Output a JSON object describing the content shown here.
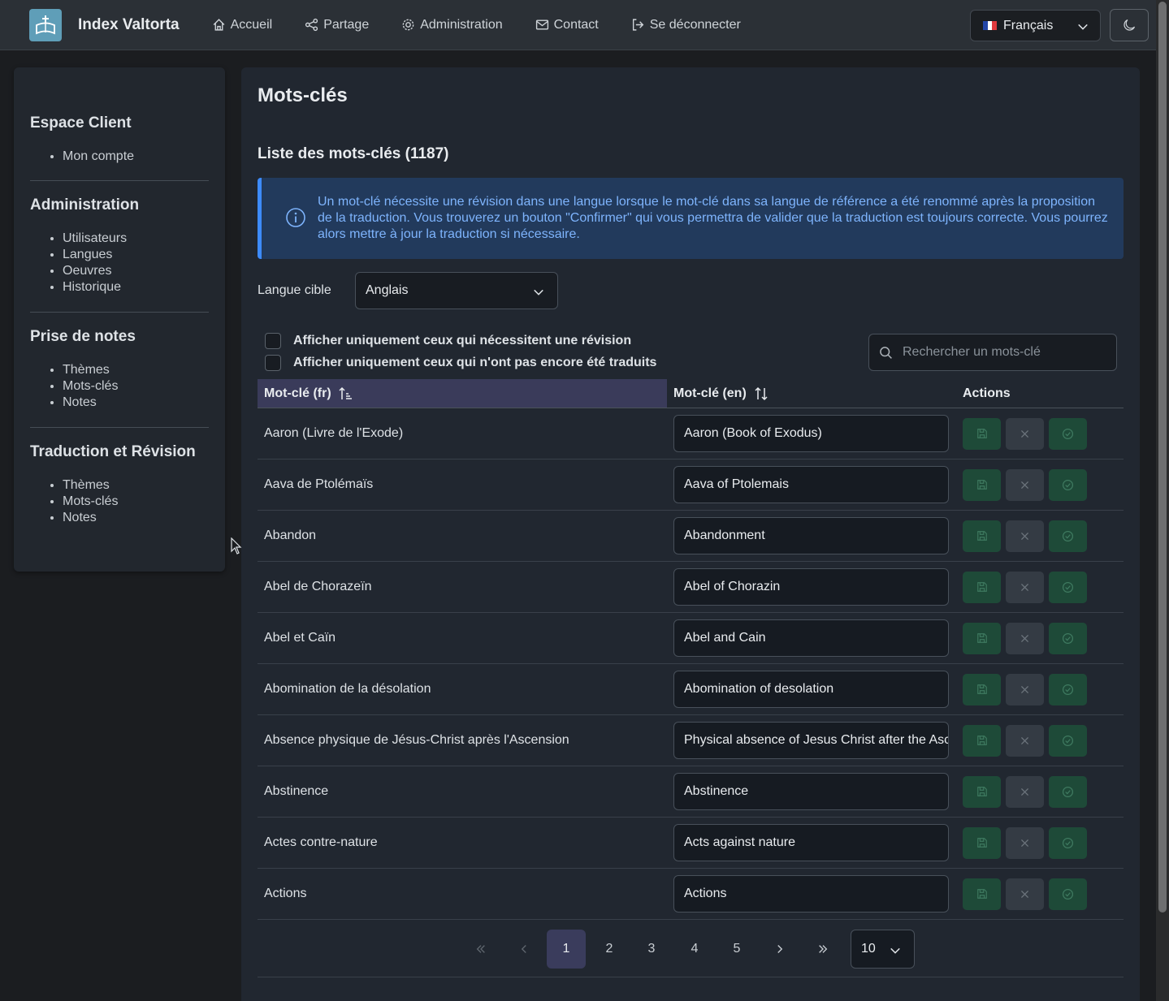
{
  "navbar": {
    "brand": "Index Valtorta",
    "items": [
      {
        "label": "Accueil",
        "icon": "home-icon"
      },
      {
        "label": "Partage",
        "icon": "share-icon"
      },
      {
        "label": "Administration",
        "icon": "gear-icon"
      },
      {
        "label": "Contact",
        "icon": "envelope-icon"
      },
      {
        "label": "Se déconnecter",
        "icon": "logout-icon"
      }
    ],
    "language": "Français",
    "theme_icon": "moon-icon"
  },
  "sidebar": {
    "sections": [
      {
        "title": "Espace Client",
        "items": [
          "Mon compte"
        ]
      },
      {
        "title": "Administration",
        "items": [
          "Utilisateurs",
          "Langues",
          "Oeuvres",
          "Historique"
        ]
      },
      {
        "title": "Prise de notes",
        "items": [
          "Thèmes",
          "Mots-clés",
          "Notes"
        ]
      },
      {
        "title": "Traduction et Révision",
        "items": [
          "Thèmes",
          "Mots-clés",
          "Notes"
        ]
      }
    ]
  },
  "main": {
    "title": "Mots-clés",
    "list_title": "Liste des mots-clés (1187)",
    "alert": "Un mot-clé nécessite une révision dans une langue lorsque le mot-clé dans sa langue de référence a été renommé après la proposition de la traduction. Vous trouverez un bouton \"Confirmer\" qui vous permettra de valider que la traduction est toujours correcte. Vous pourrez alors mettre à jour la traduction si nécessaire.",
    "target_label": "Langue cible",
    "target_value": "Anglais",
    "filter_revision": "Afficher uniquement ceux qui nécessitent une révision",
    "filter_untranslated": "Afficher uniquement ceux qui n'ont pas encore été traduits",
    "search_placeholder": "Rechercher un mots-clé"
  },
  "table": {
    "headers": {
      "fr": "Mot-clé (fr)",
      "en": "Mot-clé (en)",
      "actions": "Actions"
    },
    "rows": [
      {
        "fr": "Aaron (Livre de l'Exode)",
        "en": "Aaron (Book of Exodus)"
      },
      {
        "fr": "Aava de Ptolémaïs",
        "en": "Aava of Ptolemais"
      },
      {
        "fr": "Abandon",
        "en": "Abandonment"
      },
      {
        "fr": "Abel de Chorazeïn",
        "en": "Abel of Chorazin"
      },
      {
        "fr": "Abel et Caïn",
        "en": "Abel and Cain"
      },
      {
        "fr": "Abomination de la désolation",
        "en": "Abomination of desolation"
      },
      {
        "fr": "Absence physique de Jésus-Christ après l'Ascension",
        "en": "Physical absence of Jesus Christ after the Ascension"
      },
      {
        "fr": "Abstinence",
        "en": "Abstinence"
      },
      {
        "fr": "Actes contre-nature",
        "en": "Acts against nature"
      },
      {
        "fr": "Actions",
        "en": "Actions"
      }
    ]
  },
  "pagination": {
    "pages": [
      "1",
      "2",
      "3",
      "4",
      "5"
    ],
    "current": "1",
    "per_page": "10"
  },
  "colors": {
    "accent": "#3d8bfd",
    "success_bg": "#1e4a38",
    "active_page": "#3a3c5c"
  }
}
